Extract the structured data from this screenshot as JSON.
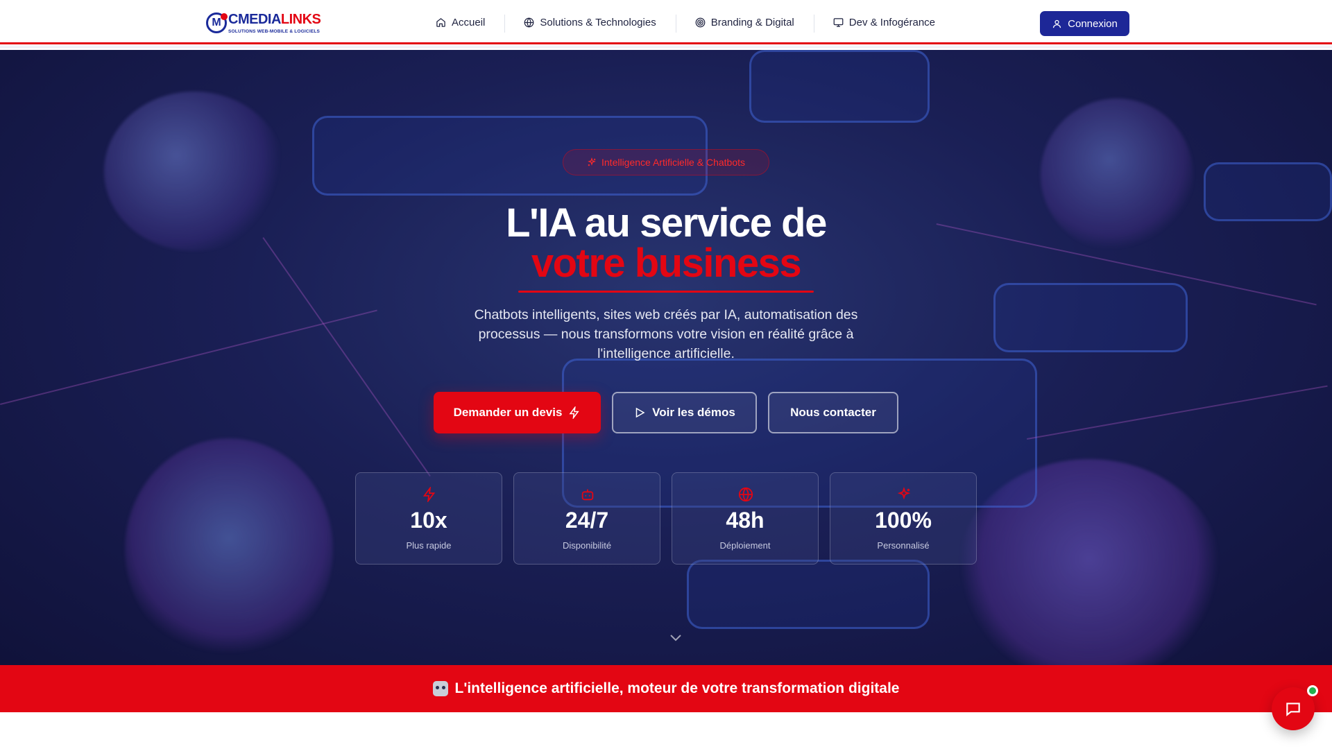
{
  "nav": {
    "logo": {
      "name_part1": "CMEDIA",
      "name_part2": "LINKS",
      "tagline": "SOLUTIONS WEB-MOBILE & LOGICIELS"
    },
    "items": [
      {
        "label": "Accueil",
        "icon": "home-icon"
      },
      {
        "label": "Solutions & Technologies",
        "icon": "globe-icon"
      },
      {
        "label": "Branding & Digital",
        "icon": "target-icon"
      },
      {
        "label": "Dev & Infogérance",
        "icon": "monitor-icon"
      }
    ],
    "login_label": "Connexion"
  },
  "hero": {
    "badge": "Intelligence Artificielle & Chatbots",
    "title_line1": "L'IA au service de",
    "title_line2": "votre business",
    "subtitle": "Chatbots intelligents, sites web créés par IA, automatisation des processus — nous transformons votre vision en réalité grâce à l'intelligence artificielle.",
    "buttons": {
      "quote": "Demander un devis",
      "demos": "Voir les démos",
      "contact": "Nous contacter"
    },
    "stats": [
      {
        "value": "10x",
        "label": "Plus rapide",
        "icon": "bolt-icon"
      },
      {
        "value": "24/7",
        "label": "Disponibilité",
        "icon": "bot-icon"
      },
      {
        "value": "48h",
        "label": "Déploiement",
        "icon": "globe-icon"
      },
      {
        "value": "100%",
        "label": "Personnalisé",
        "icon": "sparkles-icon"
      }
    ]
  },
  "banner": {
    "text": "L'intelligence artificielle, moteur de votre transformation digitale"
  },
  "colors": {
    "brand_red": "#e30613",
    "brand_navy": "#1d2797",
    "online": "#22b14c"
  }
}
